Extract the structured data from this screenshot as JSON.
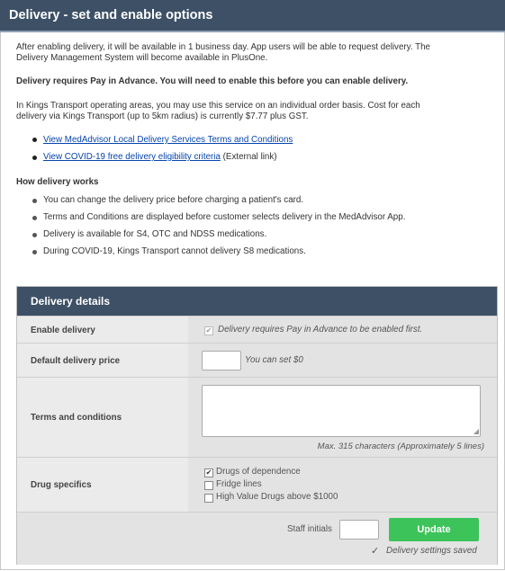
{
  "header": {
    "title": "Delivery - set and enable options"
  },
  "intro": {
    "line1": "After enabling delivery, it will be available in 1 business day. App users will be able to request delivery. The",
    "line2": "Delivery Management System will become available in PlusOne.",
    "pay_notice": "Delivery requires Pay in Advance. You will need to enable this before you can enable delivery.",
    "kings_line1": "In Kings Transport operating areas, you may use this service on an individual order basis. Cost for each",
    "kings_line2": "delivery via Kings Transport (up to 5km radius) is currently $7.77 plus GST."
  },
  "links": {
    "terms": "View MedAdvisor Local Delivery Services Terms and Conditions",
    "covid": "View COVID-19 free delivery eligibility criteria",
    "external_note": "(External link)"
  },
  "how": {
    "heading": "How delivery works",
    "items": [
      "You can change the delivery price before charging a patient's card.",
      "Terms and Conditions are displayed before customer selects delivery in the MedAdvisor App.",
      "Delivery is available for S4, OTC and NDSS medications.",
      "During COVID-19, Kings Transport cannot delivery S8 medications."
    ]
  },
  "details": {
    "title": "Delivery details",
    "enable_label": "Enable delivery",
    "enable_note": "Delivery requires Pay in Advance to be enabled first.",
    "price_label": "Default delivery price",
    "price_value": "",
    "price_hint": "You can set $0",
    "terms_label": "Terms and conditions",
    "terms_value": "",
    "terms_hint": "Max. 315 characters (Approximately 5 lines)",
    "drug_label": "Drug specifics",
    "drug_options": [
      {
        "label": "Drugs of dependence",
        "checked": true
      },
      {
        "label": "Fridge lines",
        "checked": false
      },
      {
        "label": "High Value Drugs above $1000",
        "checked": false
      }
    ],
    "staff_label": "Staff initials",
    "staff_value": "",
    "update_label": "Update",
    "saved_status": "Delivery settings saved"
  }
}
